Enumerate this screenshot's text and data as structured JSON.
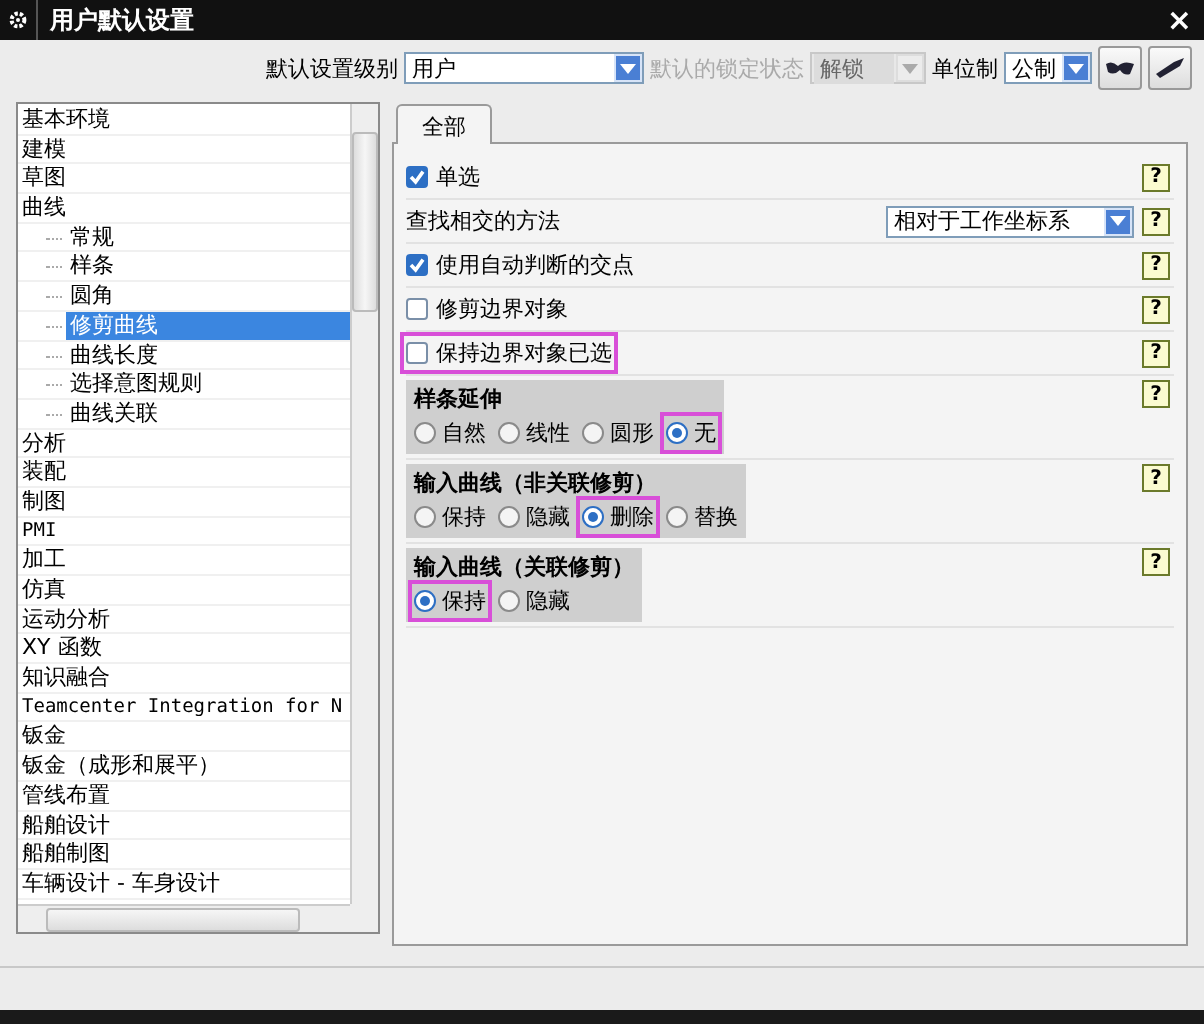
{
  "window": {
    "title": "用户默认设置",
    "close": "×"
  },
  "toolbar": {
    "level_label": "默认设置级别",
    "level_value": "用户",
    "lock_label": "默认的锁定状态",
    "lock_value": "解锁",
    "lock_disabled": true,
    "units_label": "单位制",
    "units_value": "公制"
  },
  "tree": {
    "items": [
      {
        "label": "基本环境",
        "selected": false
      },
      {
        "label": "建模",
        "selected": false
      },
      {
        "label": "草图",
        "selected": false
      },
      {
        "label": "曲线",
        "selected": false,
        "children": [
          {
            "label": "常规",
            "selected": false
          },
          {
            "label": "样条",
            "selected": false
          },
          {
            "label": "圆角",
            "selected": false
          },
          {
            "label": "修剪曲线",
            "selected": true
          },
          {
            "label": "曲线长度",
            "selected": false
          },
          {
            "label": "选择意图规则",
            "selected": false
          },
          {
            "label": "曲线关联",
            "selected": false
          }
        ]
      },
      {
        "label": "分析",
        "selected": false
      },
      {
        "label": "装配",
        "selected": false
      },
      {
        "label": "制图",
        "selected": false
      },
      {
        "label": "PMI",
        "selected": false
      },
      {
        "label": "加工",
        "selected": false
      },
      {
        "label": "仿真",
        "selected": false
      },
      {
        "label": "运动分析",
        "selected": false
      },
      {
        "label": "XY 函数",
        "selected": false
      },
      {
        "label": "知识融合",
        "selected": false
      },
      {
        "label": "Teamcenter Integration for N",
        "selected": false
      },
      {
        "label": "钣金",
        "selected": false
      },
      {
        "label": "钣金（成形和展平）",
        "selected": false
      },
      {
        "label": "管线布置",
        "selected": false
      },
      {
        "label": "船舶设计",
        "selected": false
      },
      {
        "label": "船舶制图",
        "selected": false
      },
      {
        "label": "车辆设计 - 车身设计",
        "selected": false
      }
    ]
  },
  "tabs": [
    {
      "label": "全部",
      "selected": true
    }
  ],
  "settings": [
    {
      "kind": "checkbox",
      "label": "单选",
      "checked": true,
      "highlighted": false,
      "help": "?"
    },
    {
      "kind": "dropdown",
      "label": "查找相交的方法",
      "value": "相对于工作坐标系",
      "help": "?"
    },
    {
      "kind": "checkbox",
      "label": "使用自动判断的交点",
      "checked": true,
      "highlighted": false,
      "help": "?"
    },
    {
      "kind": "checkbox",
      "label": "修剪边界对象",
      "checked": false,
      "highlighted": false,
      "help": "?"
    },
    {
      "kind": "checkbox",
      "label": "保持边界对象已选",
      "checked": false,
      "highlighted": true,
      "help": "?"
    },
    {
      "kind": "radio_group",
      "title": "样条延伸",
      "help": "?",
      "options": [
        {
          "label": "自然",
          "selected": false,
          "highlighted": false
        },
        {
          "label": "线性",
          "selected": false,
          "highlighted": false
        },
        {
          "label": "圆形",
          "selected": false,
          "highlighted": false
        },
        {
          "label": "无",
          "selected": true,
          "highlighted": true
        }
      ]
    },
    {
      "kind": "radio_group",
      "title": "输入曲线（非关联修剪）",
      "help": "?",
      "options": [
        {
          "label": "保持",
          "selected": false,
          "highlighted": false
        },
        {
          "label": "隐藏",
          "selected": false,
          "highlighted": false
        },
        {
          "label": "删除",
          "selected": true,
          "highlighted": true
        },
        {
          "label": "替换",
          "selected": false,
          "highlighted": false
        }
      ]
    },
    {
      "kind": "radio_group",
      "title": "输入曲线（关联修剪）",
      "help": "?",
      "options": [
        {
          "label": "保持",
          "selected": true,
          "highlighted": true
        },
        {
          "label": "隐藏",
          "selected": false,
          "highlighted": false
        }
      ]
    }
  ]
}
